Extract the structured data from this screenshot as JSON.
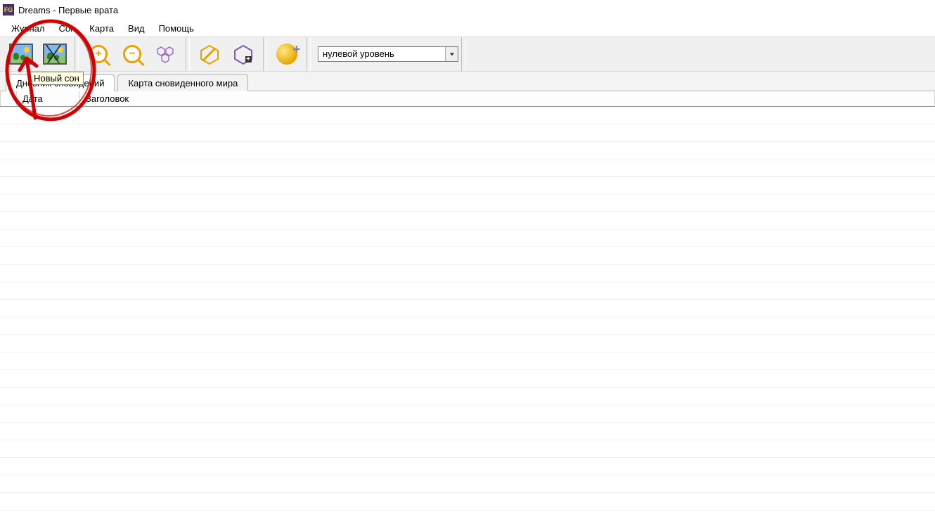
{
  "window": {
    "title": "Dreams - Первые врата",
    "app_icon_text": "FG"
  },
  "menu": {
    "items": [
      "Журнал",
      "Сон",
      "Карта",
      "Вид",
      "Помощь"
    ]
  },
  "toolbar": {
    "buttons": [
      {
        "name": "new-dream-button",
        "icon": "picture-icon"
      },
      {
        "name": "edit-dream-button",
        "icon": "picture-broken-icon"
      },
      {
        "name": "zoom-in-button",
        "icon": "zoom-in-icon"
      },
      {
        "name": "zoom-out-button",
        "icon": "zoom-out-icon"
      },
      {
        "name": "hex-grid-button",
        "icon": "hexagons-icon"
      },
      {
        "name": "draw-hex-button",
        "icon": "hex-draw-icon"
      },
      {
        "name": "hex-add-button",
        "icon": "hex-add-icon"
      },
      {
        "name": "globe-add-button",
        "icon": "globe-plus-icon"
      }
    ],
    "tooltip": "Новый сон",
    "level_combo": {
      "value": "нулевой уровень"
    }
  },
  "tabs": {
    "items": [
      {
        "label": "Дневник сновидений",
        "active": true
      },
      {
        "label": "Карта сновиденного мира",
        "active": false
      }
    ]
  },
  "list": {
    "columns": [
      "",
      "Дата",
      "Заголовок"
    ],
    "rows": []
  },
  "annotation": {
    "color": "#d00000"
  }
}
